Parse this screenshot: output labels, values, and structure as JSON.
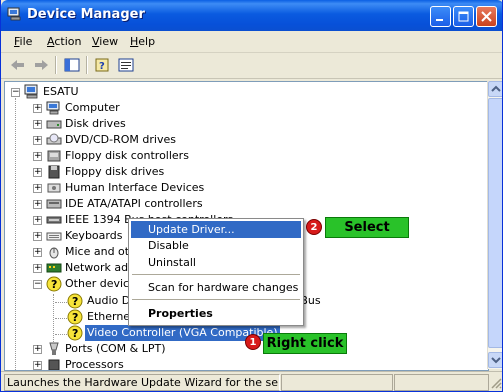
{
  "window": {
    "title": "Device Manager"
  },
  "menu": [
    "File",
    "Action",
    "View",
    "Help"
  ],
  "tree": {
    "root": "ESATU",
    "items": [
      {
        "label": "Computer",
        "icon": "computer-icon"
      },
      {
        "label": "Disk drives",
        "icon": "disk-drive-icon"
      },
      {
        "label": "DVD/CD-ROM drives",
        "icon": "cdrom-icon"
      },
      {
        "label": "Floppy disk controllers",
        "icon": "floppy-controller-icon"
      },
      {
        "label": "Floppy disk drives",
        "icon": "floppy-icon"
      },
      {
        "label": "Human Interface Devices",
        "icon": "hid-icon"
      },
      {
        "label": "IDE ATA/ATAPI controllers",
        "icon": "ide-icon"
      },
      {
        "label": "IEEE 1394 Bus host controllers",
        "icon": "ieee1394-icon"
      },
      {
        "label": "Keyboards",
        "icon": "keyboard-icon"
      },
      {
        "label": "Mice and other pointing devices",
        "icon": "mouse-icon"
      },
      {
        "label": "Network adapters",
        "icon": "network-icon"
      },
      {
        "label": "Other devices",
        "icon": "other-devices-icon"
      }
    ],
    "other_children": [
      {
        "label": "Audio Device on High Definition Audio Bus",
        "icon": "warning-device-icon"
      },
      {
        "label": "Ethernet Controller",
        "icon": "warning-device-icon"
      },
      {
        "label": "Video Controller (VGA Compatible)",
        "icon": "warning-device-icon"
      }
    ],
    "after": [
      {
        "label": "Ports (COM & LPT)",
        "icon": "port-icon"
      },
      {
        "label": "Processors",
        "icon": "processor-icon"
      }
    ]
  },
  "context_menu": {
    "items": [
      "Update Driver...",
      "Disable",
      "Uninstall",
      "Scan for hardware changes",
      "Properties"
    ]
  },
  "callouts": {
    "select": {
      "num": "2",
      "text": "Select"
    },
    "right_click": {
      "num": "1",
      "text": "Right click"
    }
  },
  "status": {
    "text": "Launches the Hardware Update Wizard for the selected device."
  },
  "colors": {
    "titlebar": "#0a5be0",
    "selection": "#316ac5",
    "callout": "#29c229",
    "badge": "#d71a1a"
  }
}
